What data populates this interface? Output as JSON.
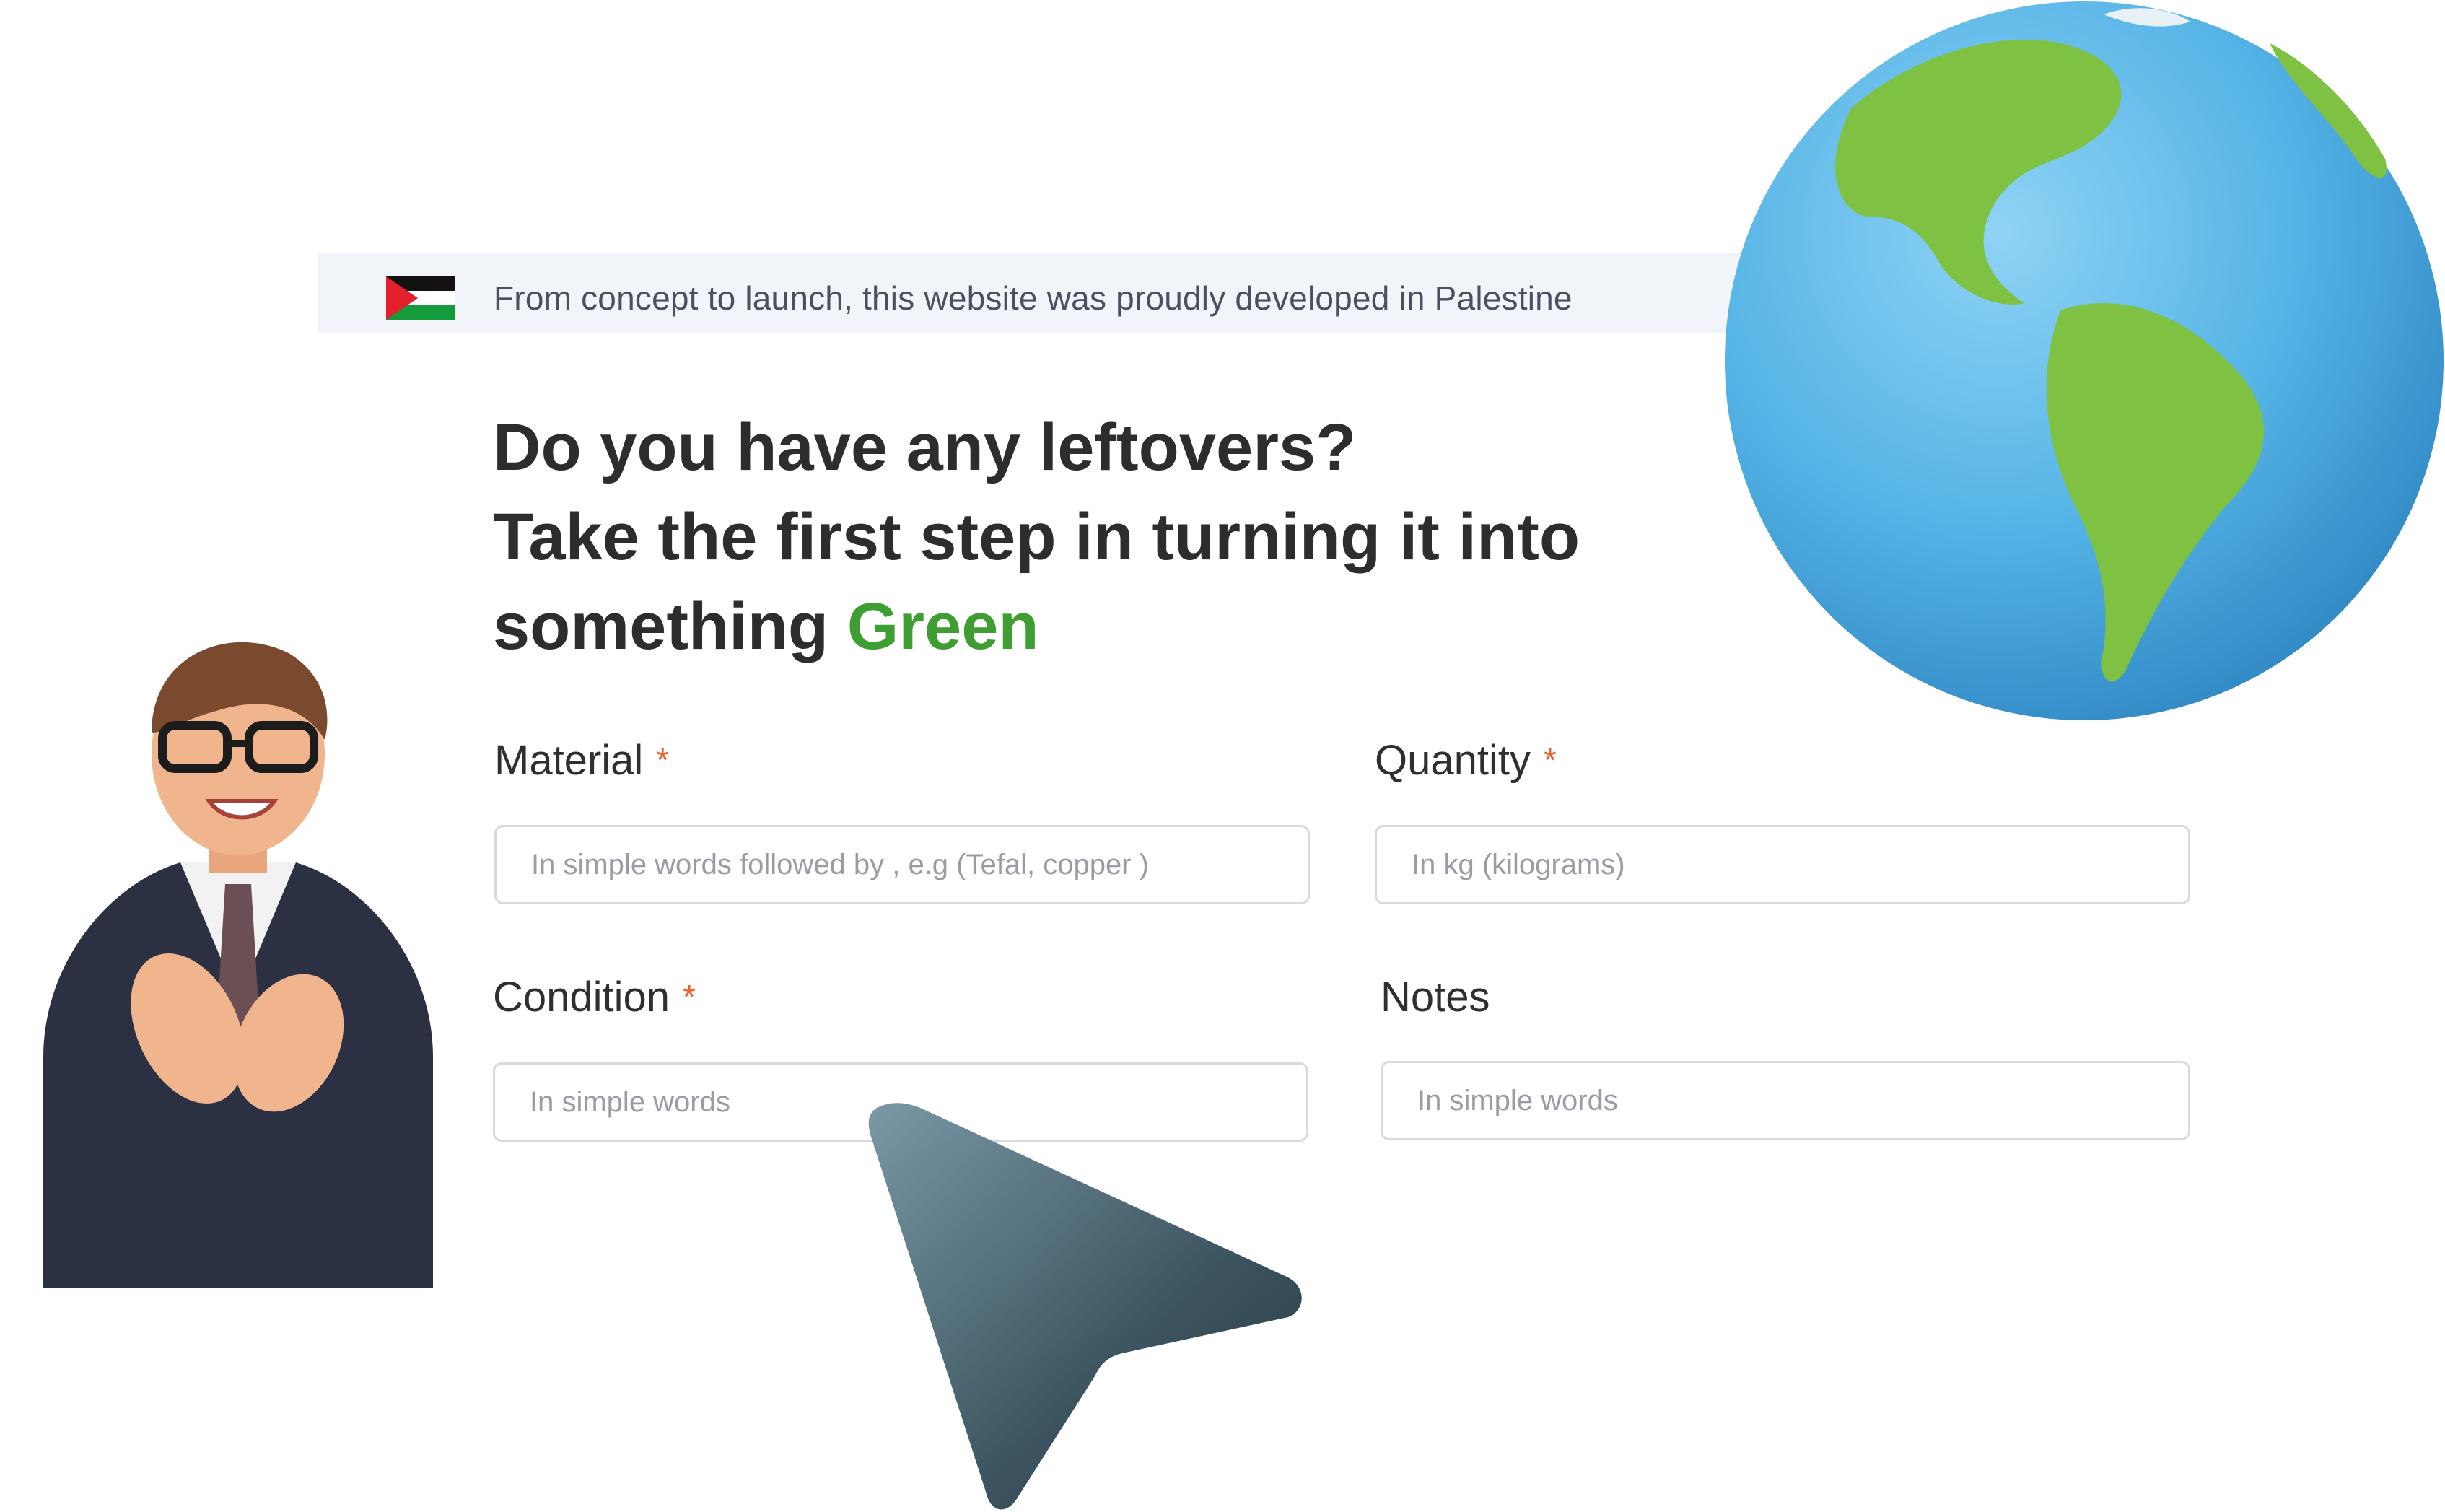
{
  "banner": {
    "flag": "palestine-flag",
    "text": "From concept to launch, this website was proudly developed in Palestine"
  },
  "headline": {
    "line1": "Do you have any leftovers?",
    "line2": "Take the first step in turning it into",
    "line3_prefix": "something ",
    "line3_accent": "Green"
  },
  "form": {
    "material": {
      "label": "Material",
      "required": "*",
      "placeholder": "In simple words followed by , e.g (Tefal, copper )"
    },
    "quantity": {
      "label": "Quantity",
      "required": "*",
      "placeholder": "In kg (kilograms)"
    },
    "condition": {
      "label": "Condition",
      "required": "*",
      "placeholder": "In simple words"
    },
    "notes": {
      "label": "Notes",
      "placeholder": "In simple words"
    }
  },
  "colors": {
    "accent_green": "#3f9e32",
    "required_orange": "#e8632a",
    "banner_bg": "#f1f5f9"
  },
  "illustrations": [
    "globe-illustration",
    "businessman-illustration",
    "cursor-pointer-illustration"
  ]
}
